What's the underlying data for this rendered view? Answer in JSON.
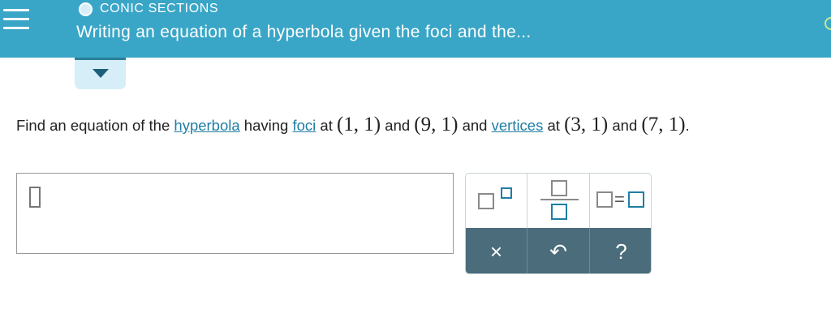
{
  "header": {
    "section_label": "CONIC SECTIONS",
    "topic_title": "Writing an equation of a hyperbola given the foci and the...",
    "colors": {
      "bar": "#3aa6c7",
      "progress_ring": "#c9e78f"
    }
  },
  "question": {
    "parts": {
      "p1": "Find an equation of the ",
      "link_hyperbola": "hyperbola",
      "p2": " having ",
      "link_foci": "foci",
      "p3": " at ",
      "m1": "(1, 1)",
      "p4": " and ",
      "m2": "(9, 1)",
      "p5": " and ",
      "link_vertices": "vertices",
      "p6": " at ",
      "m3": "(3, 1)",
      "p7": " and ",
      "m4": "(7, 1)",
      "p8": "."
    }
  },
  "answer": {
    "value": ""
  },
  "palette": {
    "buttons": [
      "superscript-template",
      "fraction-template",
      "equation-template"
    ],
    "actions": {
      "clear": "×",
      "undo": "↶",
      "help": "?"
    }
  }
}
